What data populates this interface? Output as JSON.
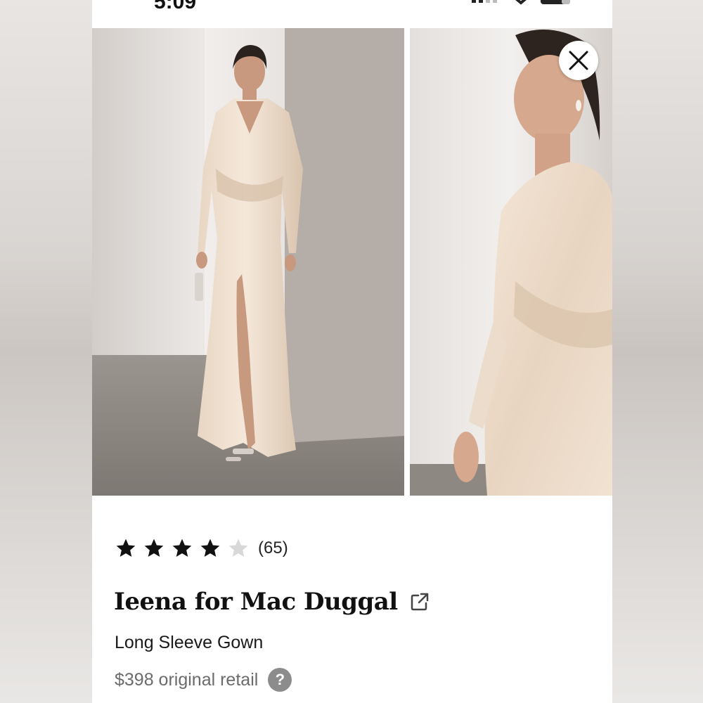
{
  "status_bar": {
    "time": "5:09",
    "battery": "35"
  },
  "product": {
    "rating": 4,
    "rating_max": 5,
    "review_count": "(65)",
    "brand": "Ieena for Mac Duggal",
    "name": "Long Sleeve Gown",
    "retail": "$398 original retail"
  },
  "icons": {
    "close": "close-icon",
    "external_link": "external-link-icon",
    "help": "question-mark-icon",
    "star_filled": "star-filled-icon",
    "star_empty": "star-empty-icon"
  },
  "colors": {
    "star_filled": "#111111",
    "star_empty": "#d8d8d8",
    "dress": "#ecdccb",
    "help_badge": "#8c8c8c"
  },
  "help_glyph": "?"
}
